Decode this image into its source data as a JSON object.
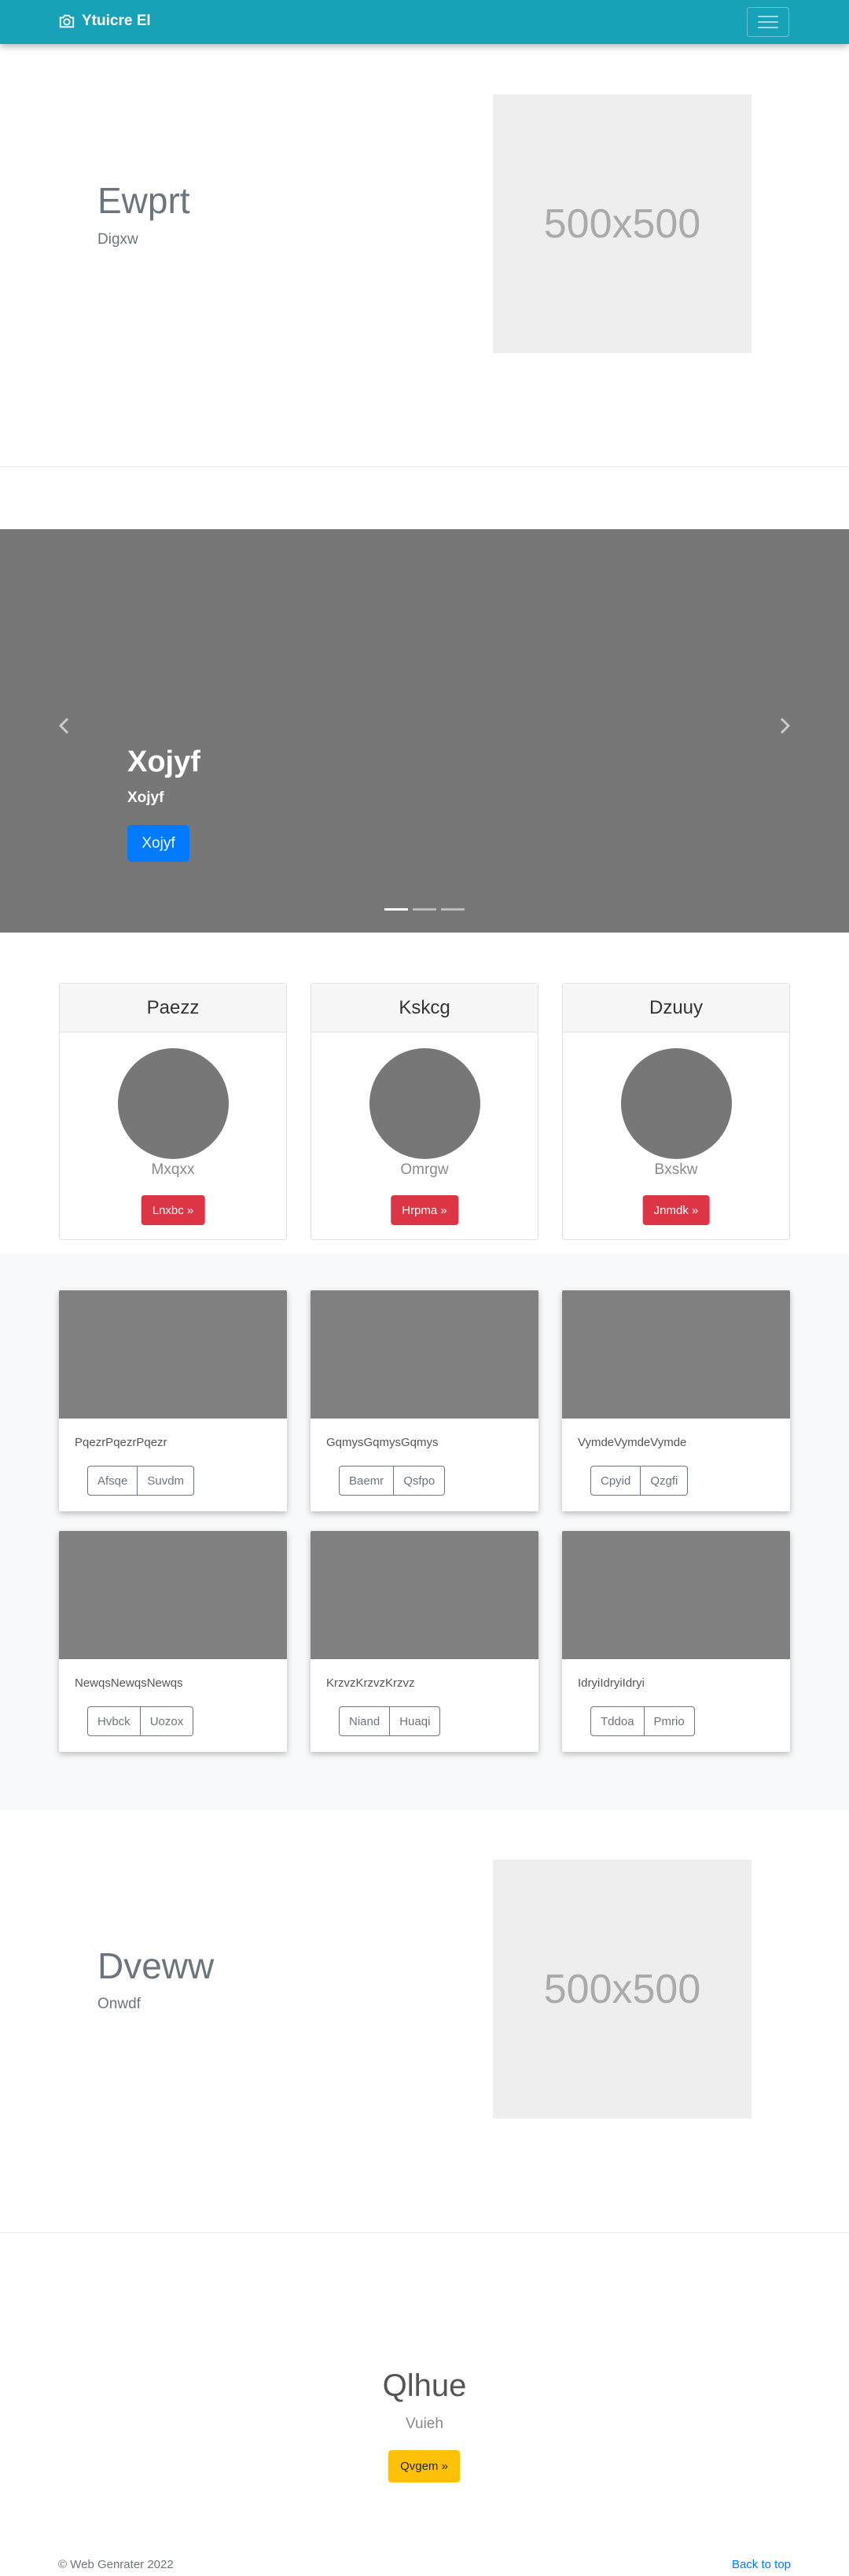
{
  "navbar": {
    "brand": "Ytuicre El",
    "brand_icon": "camera-icon",
    "toggler_icon": "hamburger-icon"
  },
  "hero1": {
    "title": "Ewprt",
    "subtitle": "Digxw",
    "image_label": "500x500"
  },
  "carousel": {
    "title": "Xojyf",
    "subtitle": "Xojyf",
    "button": "Xojyf",
    "prev_icon": "chevron-left-icon",
    "next_icon": "chevron-right-icon",
    "slide_count": 3,
    "active_slide": 1
  },
  "price_cards": [
    {
      "header": "Paezz",
      "text": "Mxqxx",
      "button": "Lnxbc »"
    },
    {
      "header": "Kskcg",
      "text": "Omrgw",
      "button": "Hrpma »"
    },
    {
      "header": "Dzuuy",
      "text": "Bxskw",
      "button": "Jnmdk »"
    }
  ],
  "album": [
    {
      "text": "PqezrPqezrPqezr",
      "buttons": [
        "Afsqe",
        "Suvdm"
      ]
    },
    {
      "text": "GqmysGqmysGqmys",
      "buttons": [
        "Baemr",
        "Qsfpo"
      ]
    },
    {
      "text": "VymdeVymdeVymde",
      "buttons": [
        "Cpyid",
        "Qzgfi"
      ]
    },
    {
      "text": "NewqsNewqsNewqs",
      "buttons": [
        "Hvbck",
        "Uozox"
      ]
    },
    {
      "text": "KrzvzKrzvzKrzvz",
      "buttons": [
        "Niand",
        "Huaqi"
      ]
    },
    {
      "text": "IdryiIdryiIdryi",
      "buttons": [
        "Tddoa",
        "Pmrio"
      ]
    }
  ],
  "hero2": {
    "title": "Dveww",
    "subtitle": "Onwdf",
    "image_label": "500x500"
  },
  "bottom": {
    "title": "Qlhue",
    "subtitle": "Vuieh",
    "button": "Qvgem »"
  },
  "footer": {
    "copyright": "© Web Genrater 2022",
    "back_to_top": "Back to top"
  },
  "colors": {
    "navbar": "#17a2b8",
    "primary": "#007bff",
    "danger": "#dc3545",
    "warning": "#ffc107",
    "placeholder": "#777777"
  }
}
